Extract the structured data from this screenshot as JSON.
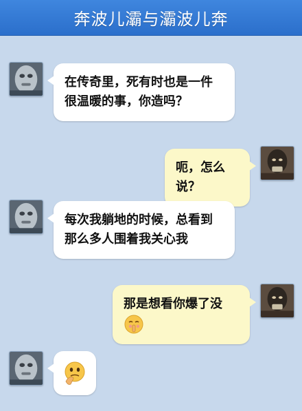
{
  "header": {
    "title": "奔波儿灞与灞波儿奔"
  },
  "messages": [
    {
      "side": "left",
      "lines": [
        "在传奇里，死有时也是一件",
        "很温暖的事，你造吗？"
      ]
    },
    {
      "side": "right",
      "lines": [
        "呃，怎么说？"
      ]
    },
    {
      "side": "left",
      "lines": [
        "每次我躺地的时候，总看到",
        "那么多人围着我关心我"
      ]
    },
    {
      "side": "right",
      "lines": [
        "那是想看你爆了没"
      ],
      "emoji": "shush-face-icon"
    },
    {
      "side": "left",
      "emoji": "thinking-face-icon"
    }
  ],
  "colors": {
    "background": "#c7d8ec",
    "title_bar": "#3a80d8",
    "left_bubble": "#ffffff",
    "right_bubble": "#fcf8c9"
  }
}
